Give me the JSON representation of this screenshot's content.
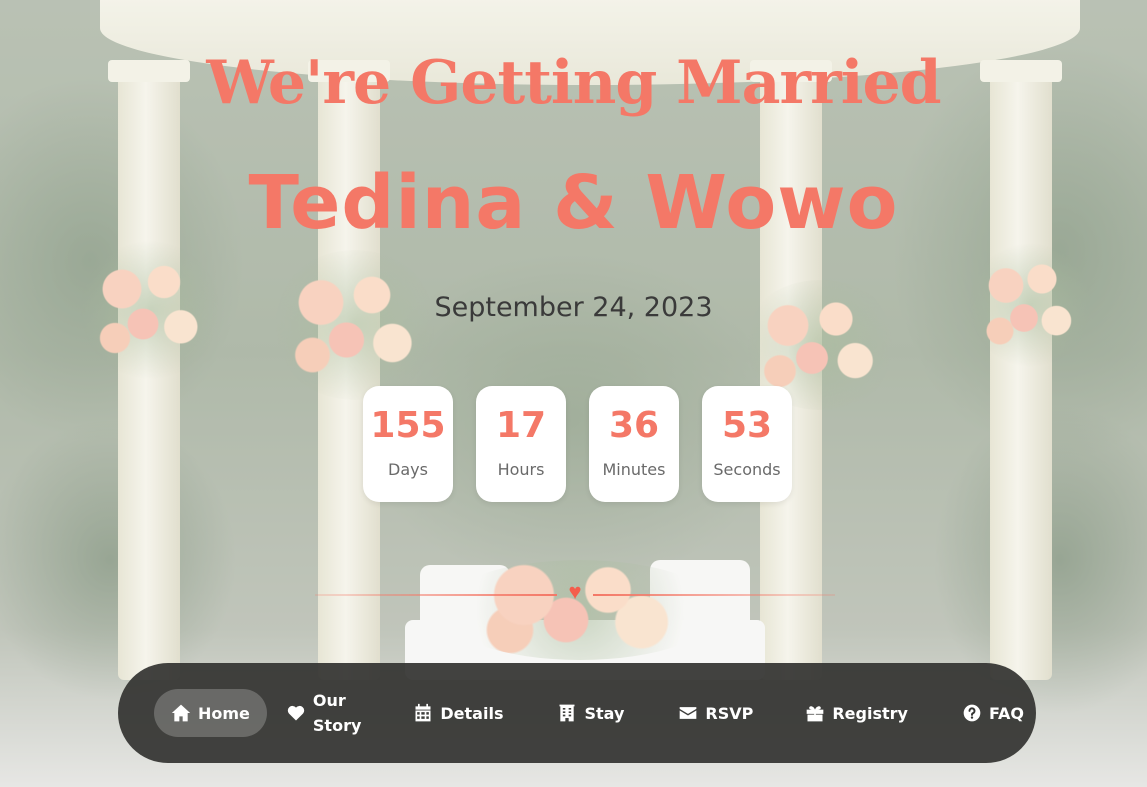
{
  "hero": {
    "heading": "We're Getting Married",
    "names": "Tedina & Wowo",
    "date": "September 24, 2023"
  },
  "countdown": [
    {
      "value": "155",
      "label": "Days"
    },
    {
      "value": "17",
      "label": "Hours"
    },
    {
      "value": "36",
      "label": "Minutes"
    },
    {
      "value": "53",
      "label": "Seconds"
    }
  ],
  "nav": {
    "items": [
      {
        "label": "Home",
        "icon": "home-icon",
        "active": true
      },
      {
        "label": "Our\nStory",
        "icon": "heart-icon",
        "active": false
      },
      {
        "label": "Details",
        "icon": "calendar-icon",
        "active": false
      },
      {
        "label": "Stay",
        "icon": "hotel-icon",
        "active": false
      },
      {
        "label": "RSVP",
        "icon": "envelope-icon",
        "active": false
      },
      {
        "label": "Registry",
        "icon": "gift-icon",
        "active": false
      },
      {
        "label": "FAQ",
        "icon": "question-circle-icon",
        "active": false
      }
    ]
  },
  "divider": {
    "icon": "heart-icon"
  },
  "colors": {
    "accent": "#f47867",
    "navbar": "#343432",
    "text_dark": "#3a3a3a"
  }
}
